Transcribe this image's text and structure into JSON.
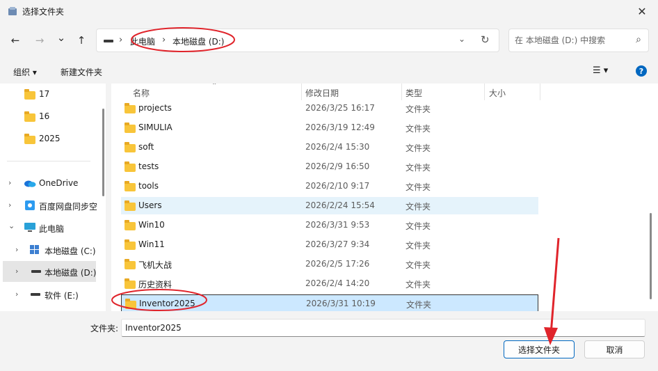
{
  "window": {
    "title": "选择文件夹",
    "close_glyph": "✕"
  },
  "nav_buttons": {
    "back": "←",
    "forward": "→",
    "recent": "⌄",
    "up": "↑"
  },
  "address_bar": {
    "crumbs": [
      "此电脑",
      "本地磁盘 (D:)"
    ],
    "separator": "›"
  },
  "search": {
    "placeholder": "在 本地磁盘 (D:) 中搜索"
  },
  "toolbar": {
    "organize": "组织",
    "organize_caret": "▾",
    "new_folder": "新建文件夹",
    "view_glyph": "☰ ▾",
    "help": "?"
  },
  "nav_pane": {
    "items": [
      {
        "label": "17",
        "kind": "folder"
      },
      {
        "label": "16",
        "kind": "folder"
      },
      {
        "label": "2025",
        "kind": "folder"
      },
      {
        "label": "OneDrive",
        "kind": "cloud",
        "chevron": "›"
      },
      {
        "label": "百度网盘同步空",
        "kind": "baidu",
        "chevron": "›"
      },
      {
        "label": "此电脑",
        "kind": "pc",
        "chevron": "⌄"
      },
      {
        "label": "本地磁盘 (C:)",
        "kind": "windows-drive",
        "chevron": "›"
      },
      {
        "label": "本地磁盘 (D:)",
        "kind": "drive",
        "chevron": "›"
      },
      {
        "label": "软件 (E:)",
        "kind": "drive",
        "chevron": "›"
      }
    ]
  },
  "columns": {
    "name": "名称",
    "modified": "修改日期",
    "type": "类型",
    "size": "大小",
    "sort_glyph": "⌃"
  },
  "files": [
    {
      "name": "projects",
      "modified": "2026/3/25 16:17",
      "type": "文件夹"
    },
    {
      "name": "SIMULIA",
      "modified": "2026/3/19 12:49",
      "type": "文件夹"
    },
    {
      "name": "soft",
      "modified": "2026/2/4 15:30",
      "type": "文件夹"
    },
    {
      "name": "tests",
      "modified": "2026/2/9 16:50",
      "type": "文件夹"
    },
    {
      "name": "tools",
      "modified": "2026/2/10 9:17",
      "type": "文件夹"
    },
    {
      "name": "Users",
      "modified": "2026/2/24 15:54",
      "type": "文件夹",
      "state": "hover"
    },
    {
      "name": "Win10",
      "modified": "2026/3/31 9:53",
      "type": "文件夹"
    },
    {
      "name": "Win11",
      "modified": "2026/3/27 9:34",
      "type": "文件夹"
    },
    {
      "name": "飞机大战",
      "modified": "2026/2/5 17:26",
      "type": "文件夹"
    },
    {
      "name": "历史资料",
      "modified": "2026/2/4 14:20",
      "type": "文件夹"
    },
    {
      "name": "Inventor2025",
      "modified": "2026/3/31 10:19",
      "type": "文件夹",
      "state": "selected"
    }
  ],
  "footer": {
    "folder_label": "文件夹:",
    "folder_value": "Inventor2025",
    "select_button": "选择文件夹",
    "cancel_button": "取消"
  },
  "colors": {
    "annotation_red": "#e0242b",
    "accent": "#0067c0",
    "folder_yellow": "#f8c53a"
  }
}
